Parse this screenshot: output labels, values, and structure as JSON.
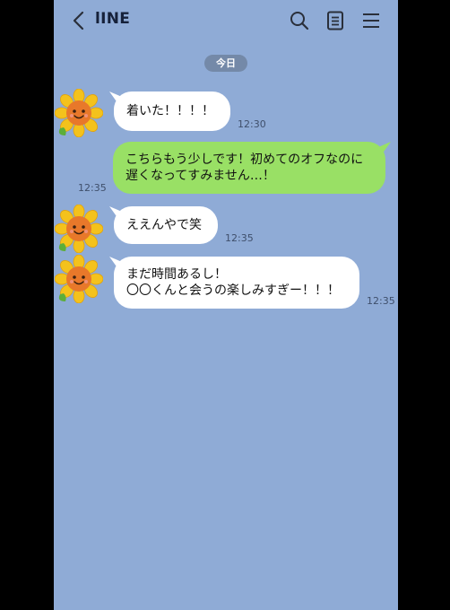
{
  "header": {
    "title": "lINE",
    "icons": [
      "back-chevron-icon",
      "search-icon",
      "notes-icon",
      "menu-icon"
    ]
  },
  "date_divider": "今日",
  "messages": [
    {
      "side": "in",
      "lines": [
        "着いた！！！！"
      ],
      "time": "12:30"
    },
    {
      "side": "out",
      "lines": [
        "こちらもう少しです！初めてのオフなのに",
        "遅くなってすみません…！"
      ],
      "time": "12:35"
    },
    {
      "side": "in",
      "lines": [
        "ええんやで笑"
      ],
      "time": "12:35"
    },
    {
      "side": "in",
      "lines": [
        "まだ時間あるし！",
        "〇〇くんと会うの楽しみすぎー！！！"
      ],
      "time": "12:35"
    }
  ],
  "colors": {
    "chat_background": "#8fabd6",
    "incoming_bubble": "#ffffff",
    "outgoing_bubble": "#99e065",
    "date_pill": "#7489a8",
    "avatar": "sunflower"
  }
}
